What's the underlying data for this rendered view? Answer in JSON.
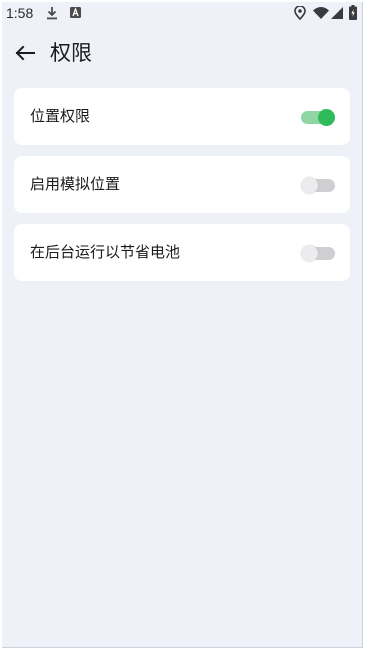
{
  "status_bar": {
    "time": "1:58",
    "icons": [
      "download-icon",
      "a-letter-icon",
      "location-icon",
      "wifi-icon",
      "cell-signal-icon",
      "battery-icon"
    ]
  },
  "header": {
    "title": "权限",
    "back_icon": "arrow-left-icon"
  },
  "colors": {
    "background": "#eff1f8",
    "card": "#ffffff",
    "switch_on_track": "#8fd6a4",
    "switch_on_thumb": "#2fbb5a",
    "switch_off_track": "#cfcfd2"
  },
  "settings": [
    {
      "label": "位置权限",
      "enabled": true
    },
    {
      "label": "启用模拟位置",
      "enabled": false
    },
    {
      "label": "在后台运行以节省电池",
      "enabled": false
    }
  ]
}
